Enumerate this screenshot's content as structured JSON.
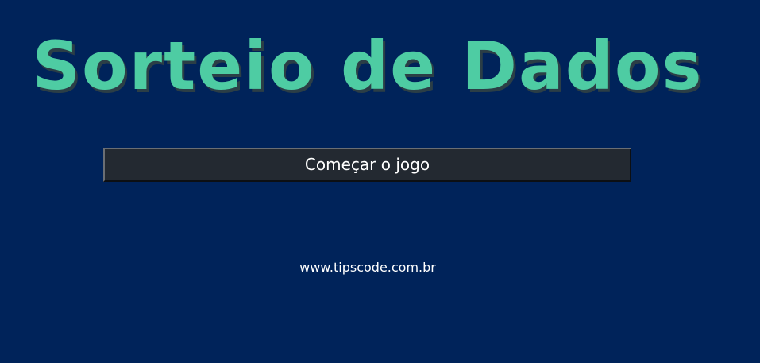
{
  "page": {
    "background_color": "#00235a"
  },
  "title": {
    "text": "Sorteio de Dados",
    "color": "#4ecca3"
  },
  "start_button": {
    "label": "Começar o jogo",
    "background_color": "#232931",
    "text_color": "#ffffff"
  },
  "footer": {
    "site_text": "www.tipscode.com.br",
    "text_color": "#ffffff"
  }
}
